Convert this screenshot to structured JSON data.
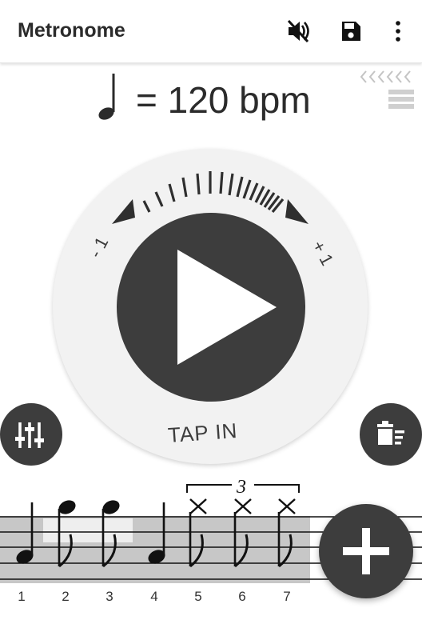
{
  "app_bar": {
    "title": "Metronome",
    "actions": [
      "volume-off-icon",
      "save-icon",
      "more-vert-icon"
    ]
  },
  "tempo": {
    "note_icon": "quarter-note-icon",
    "text": "= 120 bpm"
  },
  "side_icons": [
    "chevrons-left-icon",
    "list-icon"
  ],
  "dial": {
    "minus_label": "- 1",
    "plus_label": "+ 1",
    "tap_label": "TAP IN"
  },
  "buttons": {
    "left": "equalizer-icon",
    "right": "delete-list-icon",
    "fab": "add-icon"
  },
  "notation": {
    "tuplet_label": "3",
    "beats": [
      "1",
      "2",
      "3",
      "4",
      "5",
      "6",
      "7"
    ]
  },
  "colors": {
    "dark": "#3d3d3d",
    "dial_bg": "#f2f2f2",
    "staff_highlight": "#c7c7c7"
  }
}
